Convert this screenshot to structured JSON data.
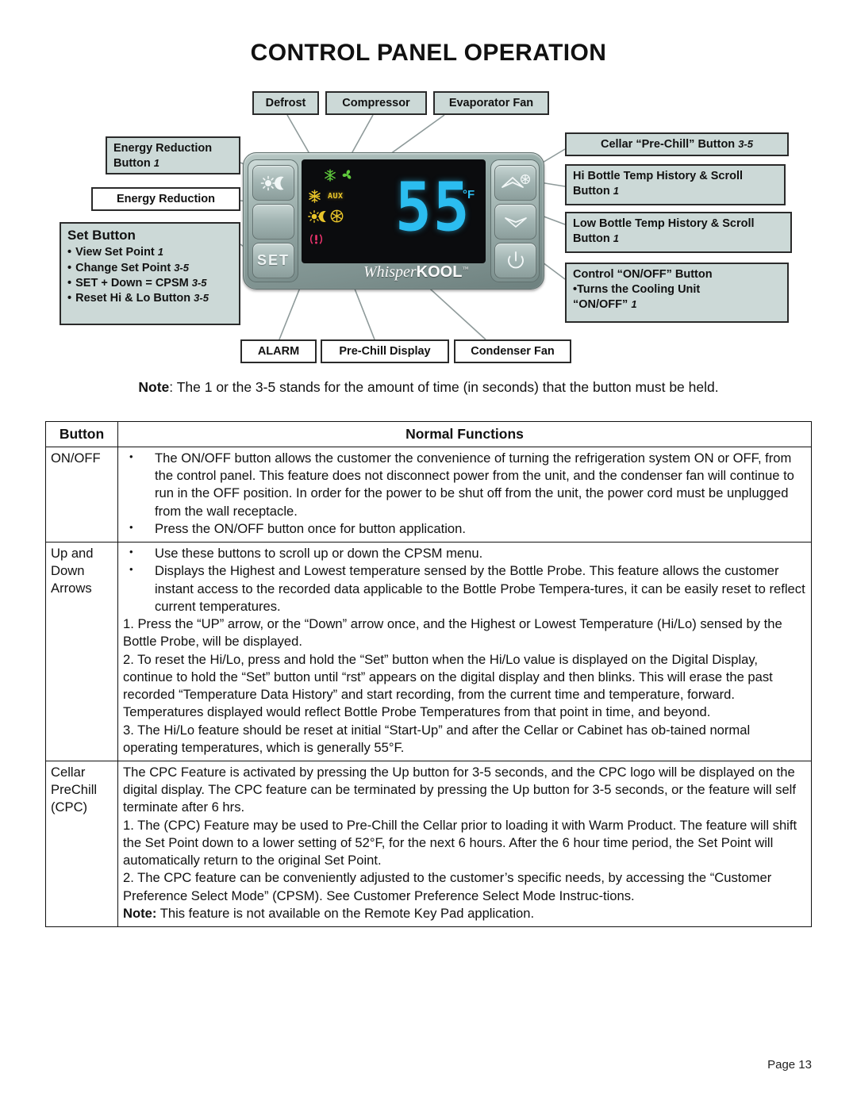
{
  "page": {
    "title": "CONTROL PANEL OPERATION",
    "page_label": "Page 13",
    "note": "Note: The 1 or the 3-5 stands for the amount of time (in seconds) that the button must be held.",
    "note_bold": "Note",
    "note_rest": ": The 1 or the 3-5 stands for the amount of time (in seconds) that the button must be held."
  },
  "colors": {
    "label_fill": "#ccd9d7",
    "panel_body": "#93a8a5",
    "display_digits": "#2bbdf0",
    "icon_green": "#5fc83c",
    "icon_yellow": "#e9c52a",
    "icon_pink": "#e8336b",
    "screen_black": "#0b0c0e"
  },
  "diagram": {
    "top_labels": [
      {
        "id": "defrost",
        "text": "Defrost"
      },
      {
        "id": "compressor",
        "text": "Compressor"
      },
      {
        "id": "evaporator-fan",
        "text": "Evaporator Fan"
      }
    ],
    "bottom_labels": [
      {
        "id": "alarm",
        "text": "ALARM"
      },
      {
        "id": "pre-chill-display",
        "text": "Pre-Chill Display"
      },
      {
        "id": "condenser-fan",
        "text": "Condenser Fan"
      }
    ],
    "left_labels": [
      {
        "id": "energy-reduction-button",
        "line1": "Energy Reduction",
        "line2": "Button",
        "seconds": "1"
      },
      {
        "id": "energy-reduction",
        "line1": "Energy Reduction",
        "line2": "",
        "seconds": ""
      }
    ],
    "set_button_box": {
      "heading": "Set Button",
      "items": [
        {
          "text": "View Set Point",
          "seconds": "1"
        },
        {
          "text": "Change Set Point",
          "seconds": "3-5"
        },
        {
          "text": "SET + Down = CPSM",
          "seconds": "3-5"
        },
        {
          "text": "Reset Hi & Lo Button",
          "seconds": "3-5"
        }
      ]
    },
    "right_labels": [
      {
        "id": "cellar-pre-chill-button",
        "line1": "Cellar “Pre-Chill” Button",
        "line2": "",
        "seconds": "3-5",
        "seconds_inline": true
      },
      {
        "id": "hi-bottle-temp",
        "line1": "Hi Bottle Temp History & Scroll",
        "line2": "Button",
        "seconds": "1"
      },
      {
        "id": "low-bottle-temp",
        "line1": "Low Bottle Temp History & Scroll",
        "line2": "Button",
        "seconds": "1"
      },
      {
        "id": "control-on-off",
        "line1": "Control “ON/OFF” Button",
        "line2": "•Turns the Cooling Unit",
        "line3": "“ON/OFF”",
        "seconds": "1"
      }
    ],
    "device": {
      "display_value": "55",
      "display_unit": "°F",
      "brand_italic": "Whisper",
      "brand_bold": "KOOL",
      "brand_tm": "™",
      "set_key_label": "SET",
      "aux_label": "AUX",
      "status_icons": [
        {
          "name": "snowflake-icon",
          "glyph": "❄",
          "color": "green"
        },
        {
          "name": "fan-icon",
          "glyph": "☘",
          "color": "green"
        },
        {
          "name": "defrost-icon",
          "glyph": "✻",
          "color": "yellow"
        },
        {
          "name": "aux-label-icon",
          "glyph": "AUX",
          "color": "yellow"
        },
        {
          "name": "energy-reduction-icon",
          "glyph": "☼☾",
          "color": "yellow"
        },
        {
          "name": "pre-chill-icon",
          "glyph": "❆",
          "color": "yellow"
        },
        {
          "name": "alarm-icon",
          "glyph": "❗",
          "color": "pink"
        }
      ]
    }
  },
  "table": {
    "headers": {
      "button": "Button",
      "functions": "Normal Functions"
    },
    "rows": [
      {
        "button": "ON/OFF",
        "blocks": [
          {
            "type": "bullet",
            "text": "The ON/OFF button allows the customer the convenience of turning the refrigeration system ON or OFF, from the control panel.  This feature does not disconnect power from the unit, and the condenser fan will continue to run in the OFF position.  In order for the power to be shut off from the unit, the power cord must be unplugged from the wall receptacle."
          },
          {
            "type": "bullet",
            "text": "Press the ON/OFF button once for button application."
          }
        ]
      },
      {
        "button": "Up and Down Arrows",
        "button_lines": [
          "Up and",
          "Down",
          "Arrows"
        ],
        "blocks": [
          {
            "type": "bullet",
            "text": "Use these buttons to scroll up or down the CPSM menu."
          },
          {
            "type": "bullet",
            "text": "Displays the Highest and Lowest temperature sensed by the Bottle Probe.  This feature allows the customer instant access to the recorded data applicable to the Bottle Probe Tempera-tures, it can be easily reset to reflect current temperatures."
          },
          {
            "type": "plain",
            "text": "1.  Press the “UP” arrow, or the “Down” arrow once, and the Highest or Lowest Temperature (Hi/Lo) sensed by the Bottle Probe, will be displayed."
          },
          {
            "type": "plain",
            "text": "2.  To reset the Hi/Lo, press and hold the “Set” button when the Hi/Lo value is displayed on the Digital Display, continue to hold the “Set” button until “rst” appears on the digital display and then blinks.  This will erase the past recorded “Temperature Data History” and start recording, from the current time and temperature, forward.  Temperatures displayed would reflect Bottle Probe Temperatures from that point in time, and beyond."
          },
          {
            "type": "plain",
            "text": "3.  The Hi/Lo feature should be reset at initial “Start-Up” and after the Cellar or Cabinet has ob-tained normal operating temperatures, which is generally 55°F."
          }
        ]
      },
      {
        "button": "Cellar PreChill (CPC)",
        "button_lines": [
          "Cellar",
          "PreChill",
          "(CPC)"
        ],
        "blocks": [
          {
            "type": "plain",
            "text": "The CPC Feature is activated by pressing the Up button for 3-5 seconds, and the CPC logo will be displayed on the digital display.  The CPC feature can be terminated by pressing the Up button for 3-5 seconds, or the feature will self terminate after 6 hrs."
          },
          {
            "type": "plain",
            "text": "1.  The (CPC) Feature may be used to Pre-Chill the Cellar prior to loading it with Warm Product.  The feature will shift the Set Point down to a lower setting of 52°F, for the next 6 hours.  After the 6 hour time period, the Set Point will automatically return to the original Set Point."
          },
          {
            "type": "plain",
            "text": "2.  The CPC feature can be conveniently adjusted to the customer’s specific needs, by accessing the “Customer Preference Select Mode” (CPSM).  See Customer Preference Select Mode Instruc-tions."
          },
          {
            "type": "note",
            "bold": "Note:",
            "text": " This feature is not available on the Remote Key Pad application."
          }
        ]
      }
    ]
  }
}
